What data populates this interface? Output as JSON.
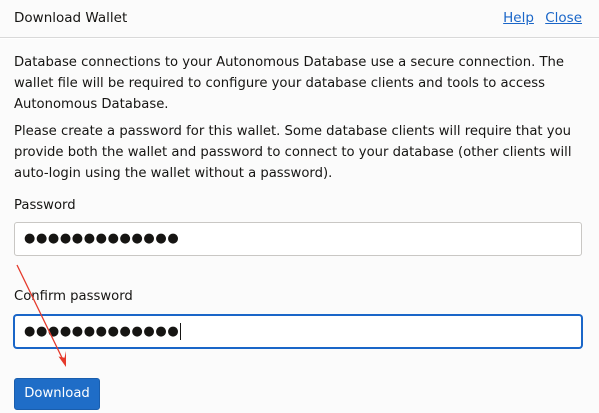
{
  "dialog": {
    "title": "Download Wallet",
    "help_label": "Help",
    "close_label": "Close"
  },
  "content": {
    "paragraph_1": "Database connections to your Autonomous Database use a secure connection. The wallet file will be required to configure your database clients and tools to access Autonomous Database.",
    "paragraph_2": "Please create a password for this wallet. Some database clients will require that you provide both the wallet and password to connect to your database (other clients will auto-login using the wallet without a password)."
  },
  "form": {
    "password_label": "Password",
    "password_value": "●●●●●●●●●●●●●",
    "confirm_label": "Confirm password",
    "confirm_value": "●●●●●●●●●●●●●",
    "download_label": "Download"
  },
  "colors": {
    "link": "#1a66c8",
    "primary_button": "#1f6dc7",
    "annotation_arrow": "#e5392b"
  }
}
